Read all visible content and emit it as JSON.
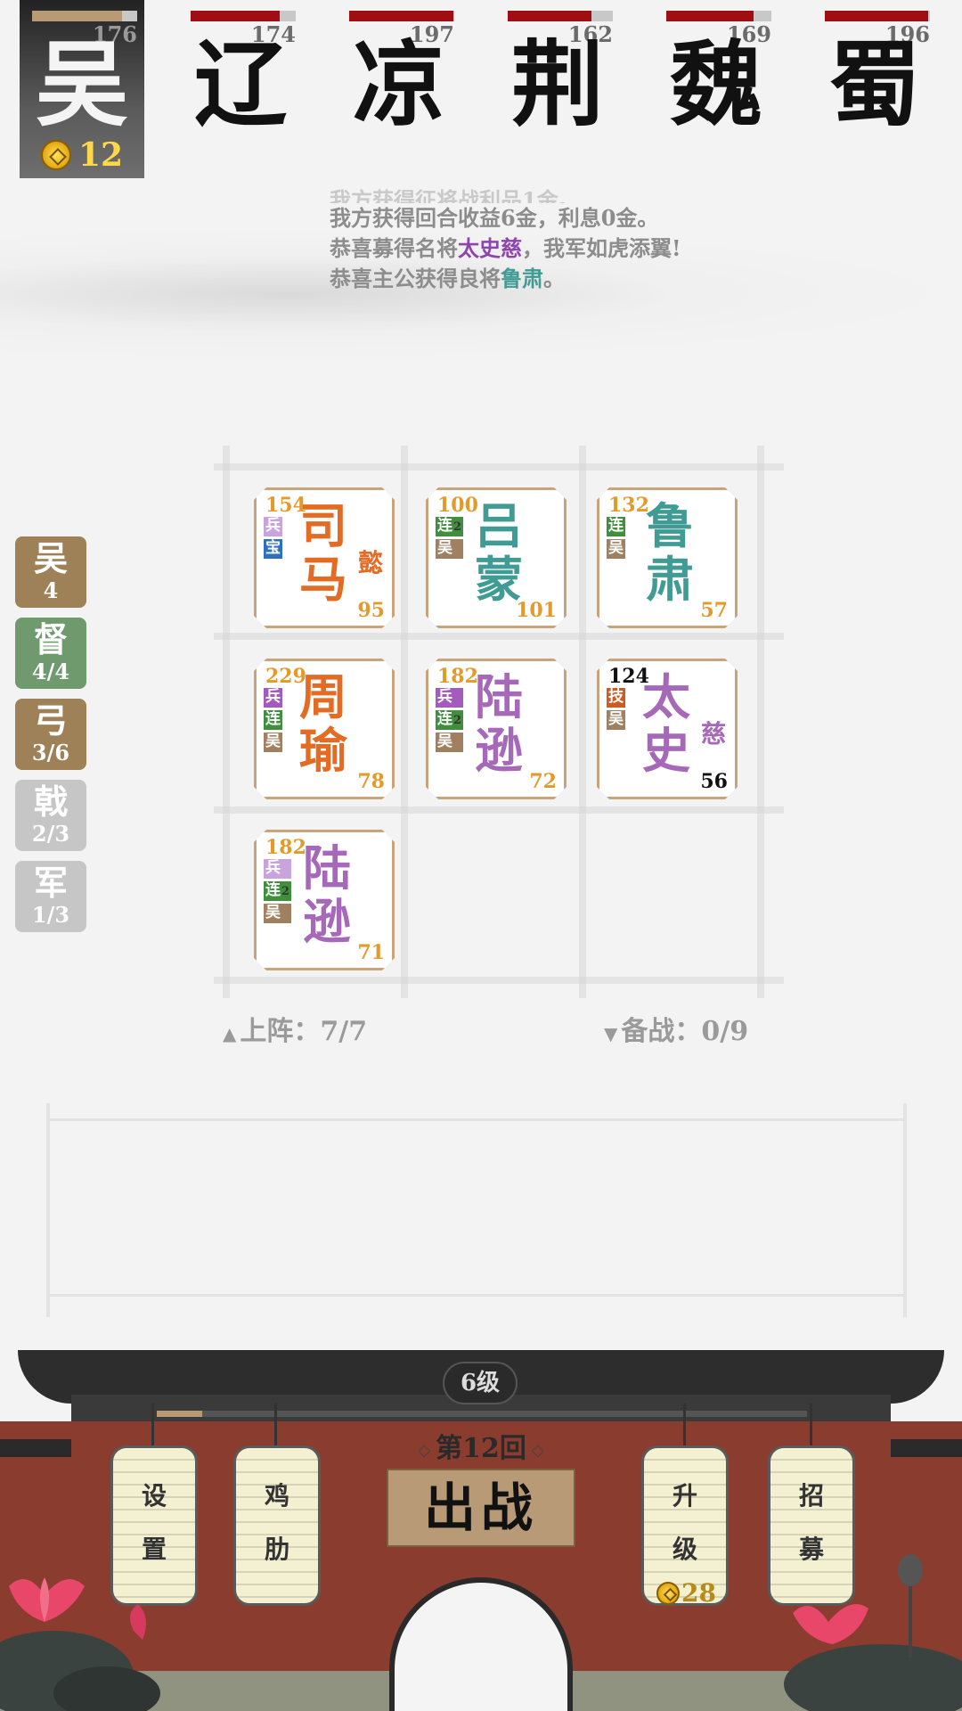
{
  "factions": [
    {
      "name": "吴",
      "hp": 176,
      "hp_ratio": 0.86,
      "active": true
    },
    {
      "name": "辽",
      "hp": 174,
      "hp_ratio": 0.85
    },
    {
      "name": "凉",
      "hp": 197,
      "hp_ratio": 0.99
    },
    {
      "name": "荆",
      "hp": 162,
      "hp_ratio": 0.8
    },
    {
      "name": "魏",
      "hp": 169,
      "hp_ratio": 0.83
    },
    {
      "name": "蜀",
      "hp": 196,
      "hp_ratio": 0.98
    }
  ],
  "gold": "12",
  "log": {
    "faded": "我方获得征将战利品1金。",
    "line1": "我方获得回合收益6金，利息0金。",
    "line2_pre": "恭喜募得名将",
    "line2_name": "太史慈",
    "line2_post": "，我军如虎添翼!",
    "line3_pre": "恭喜主公获得良将",
    "line3_name": "鲁肃",
    "line3_post": "。"
  },
  "bonds": [
    {
      "label": "吴",
      "count": "4",
      "color": "brown"
    },
    {
      "label": "督",
      "count": "4/4",
      "color": "green"
    },
    {
      "label": "弓",
      "count": "3/6",
      "color": "brown"
    },
    {
      "label": "戟",
      "count": "2/3",
      "color": "gray"
    },
    {
      "label": "军",
      "count": "1/3",
      "color": "gray"
    }
  ],
  "units": [
    {
      "cost": "154",
      "name": "司马",
      "sub": "懿",
      "power": "95",
      "tags": [
        {
          "t": "兵",
          "s": ""
        },
        {
          "t": "宝",
          "s": ""
        }
      ]
    },
    {
      "cost": "100",
      "name": "吕蒙",
      "sub": "",
      "power": "101",
      "tags": [
        {
          "t": "连",
          "s": "2"
        },
        {
          "t": "吴",
          "s": ""
        }
      ]
    },
    {
      "cost": "132",
      "name": "鲁肃",
      "sub": "",
      "power": "57",
      "tags": [
        {
          "t": "连",
          "s": ""
        },
        {
          "t": "吴",
          "s": ""
        }
      ]
    },
    {
      "cost": "229",
      "name": "周瑜",
      "sub": "",
      "power": "78",
      "tags": [
        {
          "t": "兵",
          "s": ""
        },
        {
          "t": "连",
          "s": ""
        },
        {
          "t": "吴",
          "s": ""
        }
      ]
    },
    {
      "cost": "182",
      "name": "陆逊",
      "sub": "",
      "power": "72",
      "tags": [
        {
          "t": "兵",
          "s": ""
        },
        {
          "t": "连",
          "s": "2"
        },
        {
          "t": "吴",
          "s": ""
        }
      ]
    },
    {
      "cost": "124",
      "name": "太史",
      "sub": "慈",
      "power": "56",
      "tags": [
        {
          "t": "技",
          "s": ""
        },
        {
          "t": "吴",
          "s": ""
        }
      ]
    },
    {
      "cost": "182",
      "name": "陆逊",
      "sub": "",
      "power": "71",
      "tags": [
        {
          "t": "兵",
          "s": ""
        },
        {
          "t": "连",
          "s": "2"
        },
        {
          "t": "吴",
          "s": ""
        }
      ]
    }
  ],
  "deploy": {
    "label": "上阵：",
    "value": "7/7"
  },
  "reserve": {
    "label": "备战：",
    "value": "0/9"
  },
  "level": "6级",
  "xp_ratio": 0.07,
  "round": "第12回",
  "fight_label": "出战",
  "buttons": {
    "settings": [
      "设",
      "置"
    ],
    "jile": [
      "鸡",
      "肋"
    ],
    "upgrade": [
      "升",
      "级"
    ],
    "upgrade_cost": "28",
    "recruit": [
      "招",
      "募"
    ]
  }
}
